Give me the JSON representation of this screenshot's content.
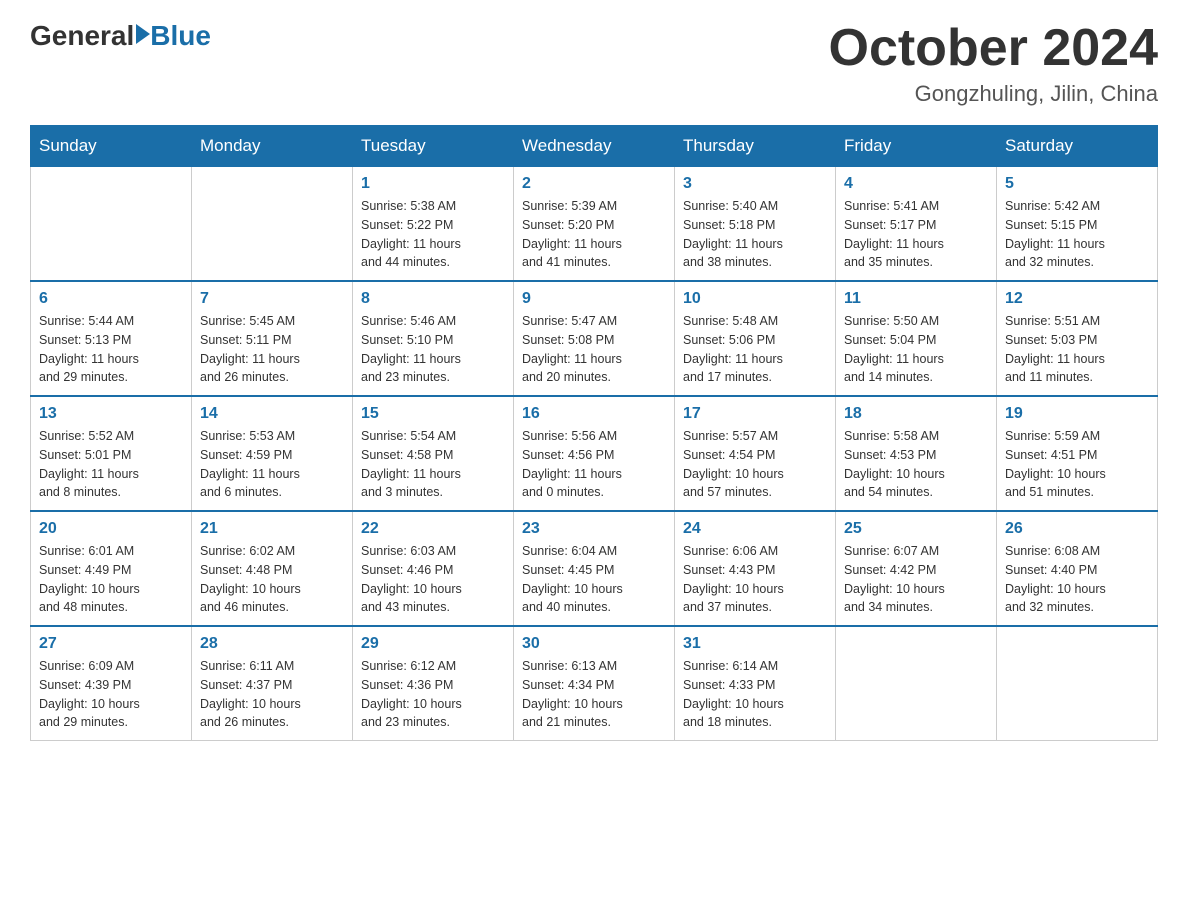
{
  "header": {
    "logo_general": "General",
    "logo_blue": "Blue",
    "month_title": "October 2024",
    "location": "Gongzhuling, Jilin, China"
  },
  "weekdays": [
    "Sunday",
    "Monday",
    "Tuesday",
    "Wednesday",
    "Thursday",
    "Friday",
    "Saturday"
  ],
  "weeks": [
    [
      {
        "day": "",
        "info": ""
      },
      {
        "day": "",
        "info": ""
      },
      {
        "day": "1",
        "info": "Sunrise: 5:38 AM\nSunset: 5:22 PM\nDaylight: 11 hours\nand 44 minutes."
      },
      {
        "day": "2",
        "info": "Sunrise: 5:39 AM\nSunset: 5:20 PM\nDaylight: 11 hours\nand 41 minutes."
      },
      {
        "day": "3",
        "info": "Sunrise: 5:40 AM\nSunset: 5:18 PM\nDaylight: 11 hours\nand 38 minutes."
      },
      {
        "day": "4",
        "info": "Sunrise: 5:41 AM\nSunset: 5:17 PM\nDaylight: 11 hours\nand 35 minutes."
      },
      {
        "day": "5",
        "info": "Sunrise: 5:42 AM\nSunset: 5:15 PM\nDaylight: 11 hours\nand 32 minutes."
      }
    ],
    [
      {
        "day": "6",
        "info": "Sunrise: 5:44 AM\nSunset: 5:13 PM\nDaylight: 11 hours\nand 29 minutes."
      },
      {
        "day": "7",
        "info": "Sunrise: 5:45 AM\nSunset: 5:11 PM\nDaylight: 11 hours\nand 26 minutes."
      },
      {
        "day": "8",
        "info": "Sunrise: 5:46 AM\nSunset: 5:10 PM\nDaylight: 11 hours\nand 23 minutes."
      },
      {
        "day": "9",
        "info": "Sunrise: 5:47 AM\nSunset: 5:08 PM\nDaylight: 11 hours\nand 20 minutes."
      },
      {
        "day": "10",
        "info": "Sunrise: 5:48 AM\nSunset: 5:06 PM\nDaylight: 11 hours\nand 17 minutes."
      },
      {
        "day": "11",
        "info": "Sunrise: 5:50 AM\nSunset: 5:04 PM\nDaylight: 11 hours\nand 14 minutes."
      },
      {
        "day": "12",
        "info": "Sunrise: 5:51 AM\nSunset: 5:03 PM\nDaylight: 11 hours\nand 11 minutes."
      }
    ],
    [
      {
        "day": "13",
        "info": "Sunrise: 5:52 AM\nSunset: 5:01 PM\nDaylight: 11 hours\nand 8 minutes."
      },
      {
        "day": "14",
        "info": "Sunrise: 5:53 AM\nSunset: 4:59 PM\nDaylight: 11 hours\nand 6 minutes."
      },
      {
        "day": "15",
        "info": "Sunrise: 5:54 AM\nSunset: 4:58 PM\nDaylight: 11 hours\nand 3 minutes."
      },
      {
        "day": "16",
        "info": "Sunrise: 5:56 AM\nSunset: 4:56 PM\nDaylight: 11 hours\nand 0 minutes."
      },
      {
        "day": "17",
        "info": "Sunrise: 5:57 AM\nSunset: 4:54 PM\nDaylight: 10 hours\nand 57 minutes."
      },
      {
        "day": "18",
        "info": "Sunrise: 5:58 AM\nSunset: 4:53 PM\nDaylight: 10 hours\nand 54 minutes."
      },
      {
        "day": "19",
        "info": "Sunrise: 5:59 AM\nSunset: 4:51 PM\nDaylight: 10 hours\nand 51 minutes."
      }
    ],
    [
      {
        "day": "20",
        "info": "Sunrise: 6:01 AM\nSunset: 4:49 PM\nDaylight: 10 hours\nand 48 minutes."
      },
      {
        "day": "21",
        "info": "Sunrise: 6:02 AM\nSunset: 4:48 PM\nDaylight: 10 hours\nand 46 minutes."
      },
      {
        "day": "22",
        "info": "Sunrise: 6:03 AM\nSunset: 4:46 PM\nDaylight: 10 hours\nand 43 minutes."
      },
      {
        "day": "23",
        "info": "Sunrise: 6:04 AM\nSunset: 4:45 PM\nDaylight: 10 hours\nand 40 minutes."
      },
      {
        "day": "24",
        "info": "Sunrise: 6:06 AM\nSunset: 4:43 PM\nDaylight: 10 hours\nand 37 minutes."
      },
      {
        "day": "25",
        "info": "Sunrise: 6:07 AM\nSunset: 4:42 PM\nDaylight: 10 hours\nand 34 minutes."
      },
      {
        "day": "26",
        "info": "Sunrise: 6:08 AM\nSunset: 4:40 PM\nDaylight: 10 hours\nand 32 minutes."
      }
    ],
    [
      {
        "day": "27",
        "info": "Sunrise: 6:09 AM\nSunset: 4:39 PM\nDaylight: 10 hours\nand 29 minutes."
      },
      {
        "day": "28",
        "info": "Sunrise: 6:11 AM\nSunset: 4:37 PM\nDaylight: 10 hours\nand 26 minutes."
      },
      {
        "day": "29",
        "info": "Sunrise: 6:12 AM\nSunset: 4:36 PM\nDaylight: 10 hours\nand 23 minutes."
      },
      {
        "day": "30",
        "info": "Sunrise: 6:13 AM\nSunset: 4:34 PM\nDaylight: 10 hours\nand 21 minutes."
      },
      {
        "day": "31",
        "info": "Sunrise: 6:14 AM\nSunset: 4:33 PM\nDaylight: 10 hours\nand 18 minutes."
      },
      {
        "day": "",
        "info": ""
      },
      {
        "day": "",
        "info": ""
      }
    ]
  ]
}
